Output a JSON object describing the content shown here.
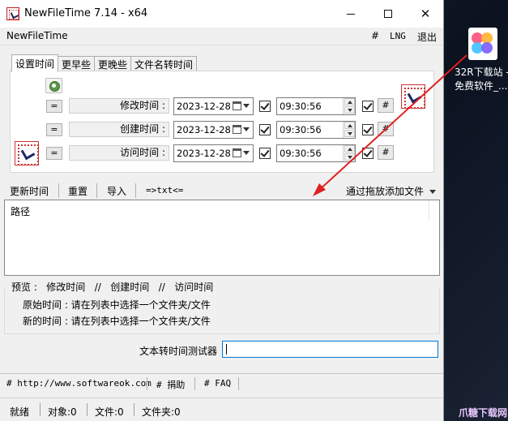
{
  "window": {
    "title": "NewFileTime 7.14 - x64",
    "controls": {
      "minimize": "minimize",
      "maximize": "maximize",
      "close": "✕"
    }
  },
  "menubar": {
    "app_name": "NewFileTime",
    "hash": "#",
    "lng": "LNG",
    "exit": "退出"
  },
  "tabs": [
    {
      "label": "设置时间",
      "active": true
    },
    {
      "label": "更早些",
      "active": false
    },
    {
      "label": "更晚些",
      "active": false
    },
    {
      "label": "文件名转时间",
      "active": false
    }
  ],
  "time_rows": [
    {
      "eq": "=",
      "label": "修改时间 :",
      "date": "2023-12-28",
      "time": "09:30:56",
      "checked_date": true,
      "checked_time": true,
      "hash": "#"
    },
    {
      "eq": "=",
      "label": "创建时间 :",
      "date": "2023-12-28",
      "time": "09:30:56",
      "checked_date": true,
      "checked_time": true,
      "hash": "#"
    },
    {
      "eq": "=",
      "label": "访问时间 :",
      "date": "2023-12-28",
      "time": "09:30:56",
      "checked_date": true,
      "checked_time": true,
      "hash": "#"
    }
  ],
  "toolbar": {
    "update": "更新时间",
    "reset": "重置",
    "import": "导入",
    "to_txt": "=>txt<=",
    "drag_add": "通过拖放添加文件"
  },
  "filelist": {
    "column": "路径"
  },
  "preview": {
    "title": "预览 :   修改时间   //   创建时间   //   访问时间",
    "original": "原始时间 : 请在列表中选择一个文件夹/文件",
    "new": "新的时间 : 请在列表中选择一个文件夹/文件"
  },
  "tester": {
    "label": "文本转时间测试器",
    "value": ""
  },
  "links": {
    "website": "# http://www.softwareok.com",
    "donate": "# 捐助",
    "faq": "# FAQ"
  },
  "status": {
    "ready": "就绪",
    "objects": "对象:0",
    "files": "文件:0",
    "folders": "文件夹:0"
  },
  "desktop": {
    "shortcut_line1": "32R下载站 -",
    "shortcut_line2": "免费软件_..."
  },
  "watermark": "爪糖下载网",
  "colors": {
    "accent_arrow": "#e02020",
    "input_focus": "#0078d7"
  }
}
